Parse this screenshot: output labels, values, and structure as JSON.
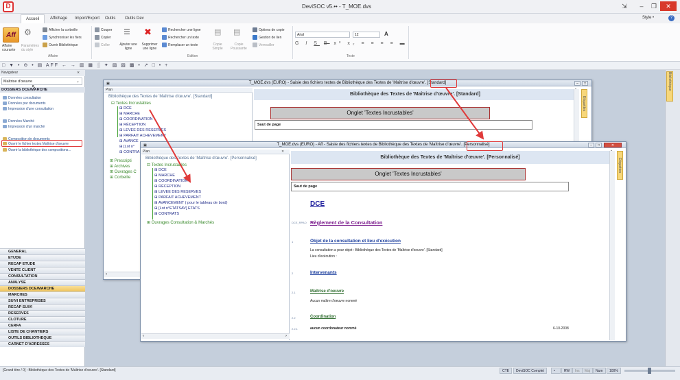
{
  "window": {
    "title": "DeviSOC v5.•• - T_MOE.dvs",
    "logo": "D"
  },
  "ribbon_tabs": [
    {
      "label": "Accueil",
      "active": true
    },
    {
      "label": "Affichage"
    },
    {
      "label": "Import/Export"
    },
    {
      "label": "Outils"
    },
    {
      "label": "Outils Dev"
    }
  ],
  "style_menu": "Style •",
  "ribbon": {
    "affaire_big": "Aff",
    "affaire_courante": "Affaire courante",
    "parametres": "Paramètres du style",
    "afficher_corbeille": "Afficher la corbeille",
    "synchroniser": "Synchroniser les fiers",
    "ouvrir_biblio": "Ouvrir Bibliothèque",
    "couper": "Couper",
    "copier": "Copier",
    "coller": "Coller",
    "ajouter": "Ajouter une ligne",
    "supprimer": "Supprimer une ligne",
    "rechercher_ligne": "Rechercher une ligne",
    "rechercher_texte": "Rechercher un texte",
    "remplacer_texte": "Remplacer un texte",
    "copie_simple": "Copie Simple",
    "copie_poussante": "Copie Poussante",
    "options_copie": "Options de copie",
    "gestion_lien": "Gestion de lien",
    "verrouiller": "Verrouiller",
    "font_name": "Arial",
    "font_size": "12",
    "groups": {
      "affaire": "Affaire",
      "edition": "Edition",
      "texte": "Texte"
    }
  },
  "quick_toolbar": "□ ▼ • ⊖ • ▤ AFF ← → ▥ ▦ ░ ✦ ▧ ▨ ▩ • ↗ □ • +",
  "navigator": {
    "title": "Navigateur",
    "pin": "⨯",
    "selected": "Maîtrise d'oeuvre",
    "section": "DOSSIERS DCE/MARCHE",
    "links": [
      "Données consultation",
      "Données par documents",
      "Impression d'une consultation",
      "Données Marché",
      "Impression d'un marché",
      "Composition de documents",
      "Ouvrir le fichier textes Maîtrise d'oeuvre",
      "Ouvrir la bibliothèque des compositions..."
    ],
    "modules": [
      "GENERAL",
      "ETUDE",
      "RECAP ETUDE",
      "VENTE CLIENT",
      "CONSULTATION",
      "ANALYSE",
      "DOSSIERS DCE/MARCHE",
      "MARCHES",
      "SUIVI ENTREPRISES",
      "RECAP SUIVI",
      "RESERVES",
      "CLOTURE",
      "CERFA",
      "LISTE DE CHANTIERS",
      "OUTILS BIBLIOTHEQUE",
      "CARNET D'ADRESSES"
    ]
  },
  "right_panel": {
    "bibliotheque": "Bibliothèque"
  },
  "win1": {
    "title": "T_MOE.dvs (EURO) - Saisie des fichiers textes de Bibliothèque des Textes  de 'Maîtrise d'œuvre'.",
    "title_tag": "[Standard]",
    "plan": "Plan",
    "tree_root": "Bibliothèque des Textes  de 'Maîtrise d'œuvre'. [Standard]",
    "textes": "Textes Incrustables",
    "items": [
      "DCE",
      "MARCHE",
      "COORDINATION",
      "RÉCEPTION",
      "LEVEE DES RESERVES",
      "PARFAIT ACHEVEMENT",
      "AVANCE",
      "[Lot n°",
      "CONTRA"
    ],
    "groups": [
      "Prescripti",
      "Archives",
      "Ouvrages C",
      "Corbeille"
    ],
    "header": "Bibliothèque des Textes  de 'Maîtrise d'œuvre'. [Standard]",
    "onglet": "Onglet 'Textes Incrustables'",
    "saut": "Saut de page",
    "etiquettes": "Etiquettes"
  },
  "win2": {
    "title": "T_MOE.dvs (EURO) - Aff - Saisie des fichiers textes de Bibliothèque des Textes  de 'Maîtrise d'œuvre'.",
    "title_tag": "[Personnalisé]",
    "plan": "Plan",
    "tree_root": "Bibliothèque des Textes  de 'Maîtrise d'œuvre'. [Personnalisé]",
    "textes": "Textes Incrustables",
    "items": [
      "DCE",
      "MARCHE",
      "COORDINATION",
      "RÉCEPTION",
      "LEVEE DES RESERVES",
      "PARFAIT ACHEVEMENT",
      "AVANCEMENT ( pour le tableau de bord)",
      "[Lot n°ETATSAV] ETATS",
      "CONTRATS"
    ],
    "ouvrages": "Ouvrages Consultation & Marchés",
    "header": "Bibliothèque des Textes  de 'Maîtrise d'œuvre'. [Personnalisé]",
    "onglet": "Onglet 'Textes Incrustables'",
    "saut": "Saut de page",
    "etiquettes": "Etiquettes",
    "doc": {
      "dce": "DCE",
      "rc_idx": "DCE_RPAO",
      "rc": "Règlement de la Consultation",
      "obj_idx": "1",
      "obj": "Objet de la consultation et lieu d'exécution",
      "obj_p1": "La consultation a pour objet : Bibliothèque des Textes  de 'Maîtrise d'oeuvre'. [Standard]",
      "obj_p2": "Lieu d'exécution :",
      "int_idx": "2",
      "int": "Intervenants",
      "mo_idx": "2.1",
      "mo": "Maîtrise d'oeuvre",
      "mo_p": "Aucun maître d'oeuvre nommé",
      "co_idx": "2.2",
      "co": "Coordination",
      "co_idx2": "2.2.1",
      "co_p": "aucun coordonateur nommé",
      "co_date": "6-10-2008"
    }
  },
  "status": {
    "text": "[Grand titre / 0] : Bibliothèque des Textes  de 'Maîtrise d'oeuvre'. [Standard]",
    "cells": [
      "CTE",
      "DeviSOC Complet",
      "•",
      "RW",
      "Ins",
      "Maj",
      "Num",
      "100%"
    ]
  }
}
